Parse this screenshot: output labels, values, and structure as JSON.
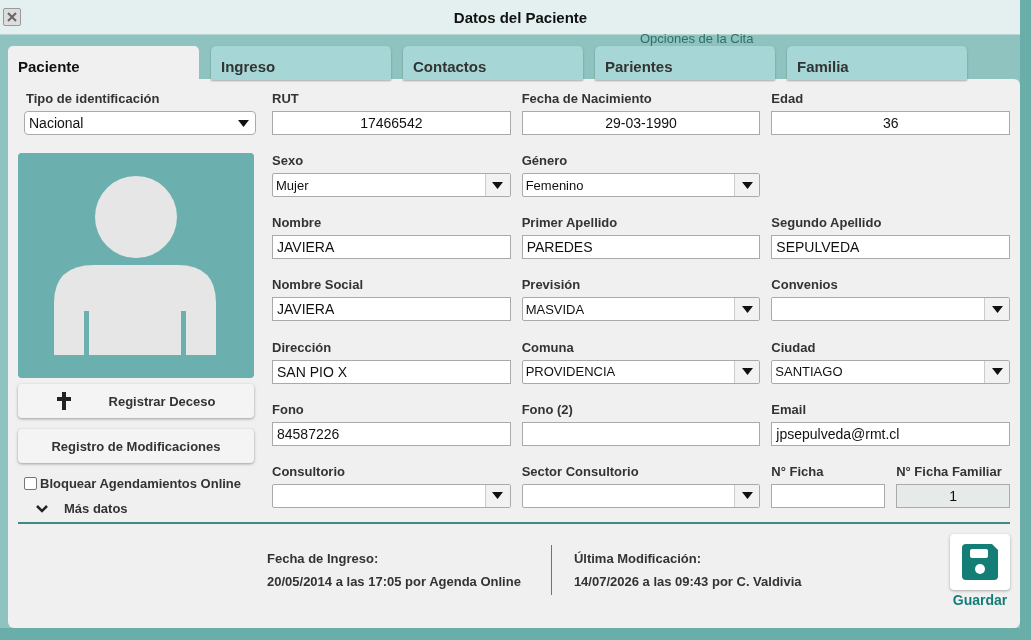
{
  "window": {
    "title": "Datos del Paciente"
  },
  "background_text": "Opciones de la Cita",
  "tabs": [
    {
      "label": "Paciente",
      "selected": true
    },
    {
      "label": "Ingreso",
      "selected": false
    },
    {
      "label": "Contactos",
      "selected": false
    },
    {
      "label": "Parientes",
      "selected": false
    },
    {
      "label": "Familia",
      "selected": false
    }
  ],
  "id_type": {
    "label": "Tipo de identificación",
    "value": "Nacional"
  },
  "side_buttons": [
    {
      "label": "Registrar Deceso",
      "kind": "cross"
    },
    {
      "label": "Registro de Modificaciones",
      "kind": "plain"
    }
  ],
  "block_online": {
    "label": "Bloquear Agendamientos Online",
    "checked": false
  },
  "more": {
    "label": "Más datos",
    "expanded": false
  },
  "rows": [
    [
      {
        "label": "RUT",
        "value": "17466542",
        "kind": "centered"
      },
      {
        "label": "Fecha de Nacimiento",
        "value": "29-03-1990",
        "kind": "centered"
      },
      {
        "label": "Edad",
        "value": "36",
        "kind": "centered"
      }
    ],
    [
      {
        "label": "Sexo",
        "value": "Mujer",
        "kind": "select"
      },
      {
        "label": "Género",
        "value": "Femenino",
        "kind": "select"
      }
    ],
    [
      {
        "label": "Nombre",
        "value": "JAVIERA",
        "kind": "text"
      },
      {
        "label": "Primer Apellido",
        "value": "PAREDES",
        "kind": "text"
      },
      {
        "label": "Segundo Apellido",
        "value": "SEPULVEDA",
        "kind": "text"
      }
    ],
    [
      {
        "label": "Nombre Social",
        "value": "JAVIERA",
        "kind": "text"
      },
      {
        "label": "Previsión",
        "value": "MASVIDA",
        "kind": "select"
      },
      {
        "label": "Convenios",
        "kind": "select"
      }
    ],
    [
      {
        "label": "Dirección",
        "value": "SAN PIO X",
        "kind": "text"
      },
      {
        "label": "Comuna",
        "value": "PROVIDENCIA",
        "kind": "select"
      },
      {
        "label": "Ciudad",
        "value": "SANTIAGO",
        "kind": "select"
      }
    ],
    [
      {
        "label": "Fono",
        "value": "84587226",
        "kind": "text"
      },
      {
        "label": "Fono (2)",
        "kind": "text"
      },
      {
        "label": "Email",
        "value": "jpsepulveda@rmt.cl",
        "kind": "text"
      }
    ],
    [
      {
        "label": "Consultorio",
        "kind": "select"
      },
      {
        "label": "Sector Consultorio",
        "kind": "select"
      },
      {
        "label": "N° Ficha",
        "kind": "text"
      },
      {
        "label": "N° Ficha Familiar",
        "value": "1",
        "kind": "readonly"
      }
    ]
  ],
  "footer": [
    {
      "label": "Fecha de Ingreso:",
      "value": "20/05/2014 a las 17:05 por Agenda Online"
    },
    {
      "label": "Última Modificación:",
      "value": "14/07/2026 a las 09:43 por C. Valdivia"
    }
  ],
  "save": {
    "label": "Guardar"
  }
}
